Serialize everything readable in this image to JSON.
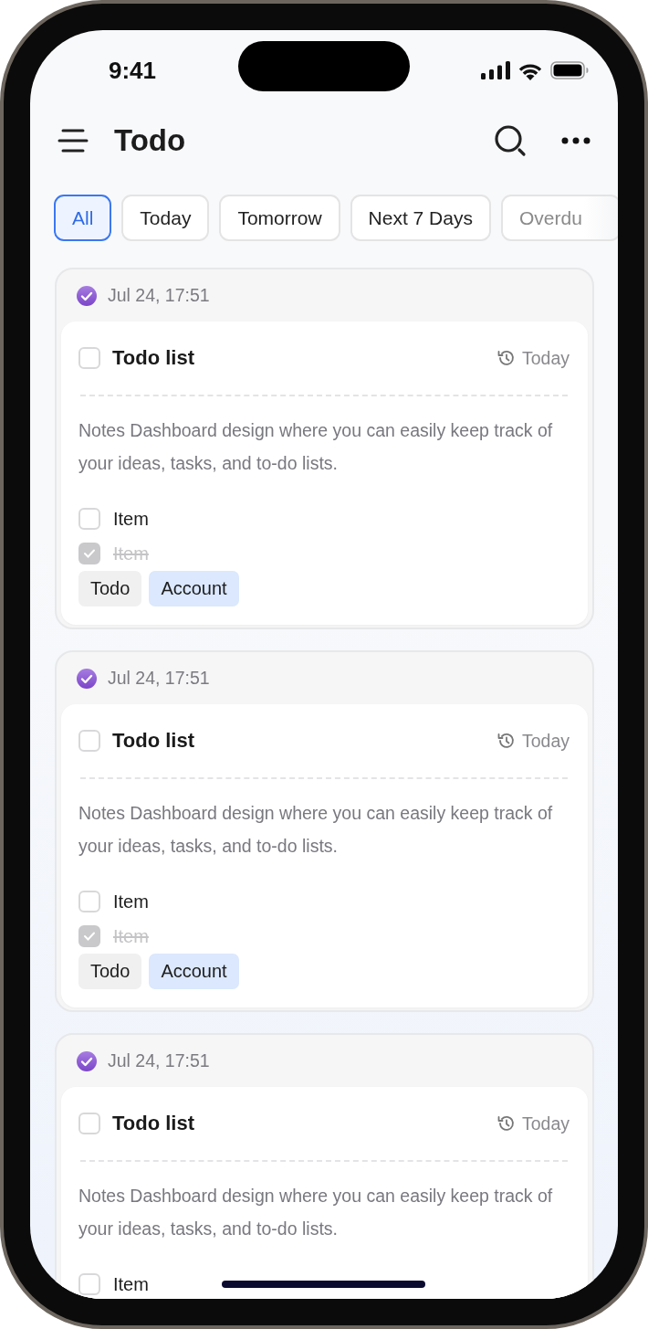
{
  "status_bar": {
    "time": "9:41"
  },
  "header": {
    "title": "Todo"
  },
  "filters": [
    {
      "label": "All",
      "selected": true
    },
    {
      "label": "Today",
      "selected": false
    },
    {
      "label": "Tomorrow",
      "selected": false
    },
    {
      "label": "Next 7 Days",
      "selected": false
    },
    {
      "label": "Overdu",
      "selected": false
    }
  ],
  "notes": [
    {
      "date": "Jul 24, 17:51",
      "title": "Todo list",
      "checked": false,
      "due": "Today",
      "description": "Notes Dashboard design where you can easily keep track of your ideas, tasks, and to-do lists.",
      "items": [
        {
          "text": "Item",
          "checked": false
        },
        {
          "text": "Item",
          "checked": true
        }
      ],
      "tags": [
        {
          "label": "Todo",
          "color": "#f0f0f0"
        },
        {
          "label": "Account",
          "color": "#dbe8fd"
        }
      ]
    },
    {
      "date": "Jul 24, 17:51",
      "title": "Todo list",
      "checked": false,
      "due": "Today",
      "description": "Notes Dashboard design where you can easily keep track of your ideas, tasks, and to-do lists.",
      "items": [
        {
          "text": "Item",
          "checked": false
        },
        {
          "text": "Item",
          "checked": true
        }
      ],
      "tags": [
        {
          "label": "Todo",
          "color": "#f0f0f0"
        },
        {
          "label": "Account",
          "color": "#dbe8fd"
        }
      ]
    },
    {
      "date": "Jul 24, 17:51",
      "title": "Todo list",
      "checked": false,
      "due": "Today",
      "description": "Notes Dashboard design where you can easily keep track of your ideas, tasks, and to-do lists.",
      "items": [
        {
          "text": "Item",
          "checked": false
        }
      ]
    }
  ]
}
